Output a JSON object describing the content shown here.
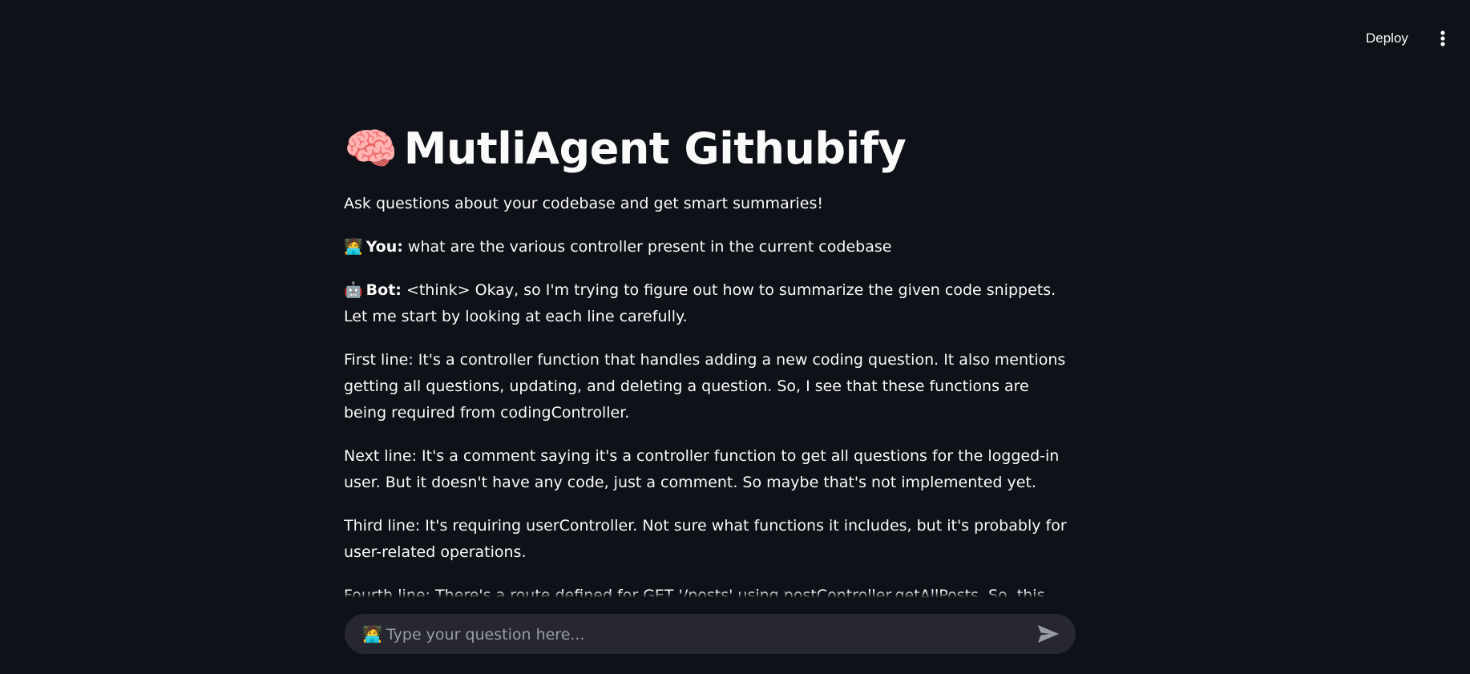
{
  "header": {
    "deploy_label": "Deploy",
    "menu_icon": "kebab-menu-icon"
  },
  "app": {
    "title_emoji": "🧠",
    "title": "MutliAgent Githubify",
    "subtitle": "Ask questions about your codebase and get smart summaries!"
  },
  "messages": [
    {
      "avatar": "🧑‍💻",
      "role_label": "You:",
      "text": "what are the various controller present in the current codebase"
    },
    {
      "avatar": "🤖",
      "role_label": "Bot:",
      "text": "<think> Okay, so I'm trying to figure out how to summarize the given code snippets. Let me start by looking at each line carefully."
    }
  ],
  "bot_paragraphs": [
    "First line: It's a controller function that handles adding a new coding question. It also mentions getting all questions, updating, and deleting a question. So, I see that these functions are being required from codingController.",
    "Next line: It's a comment saying it's a controller function to get all questions for the logged-in user. But it doesn't have any code, just a comment. So maybe that's not implemented yet.",
    "Third line: It's requiring userController. Not sure what functions it includes, but it's probably for user-related operations.",
    "Fourth line: There's a route defined for GET '/posts' using postController.getAllPosts. So, this route is set"
  ],
  "chat_input": {
    "avatar": "🧑‍💻",
    "placeholder": "Type your question here...",
    "value": "",
    "send_icon": "send-icon"
  },
  "colors": {
    "background": "#0e1117",
    "input_background": "#262730",
    "text": "#fafafa",
    "placeholder": "#9a9ca4",
    "accent_start": "#ff4b4b",
    "accent_end": "#fffd80"
  }
}
